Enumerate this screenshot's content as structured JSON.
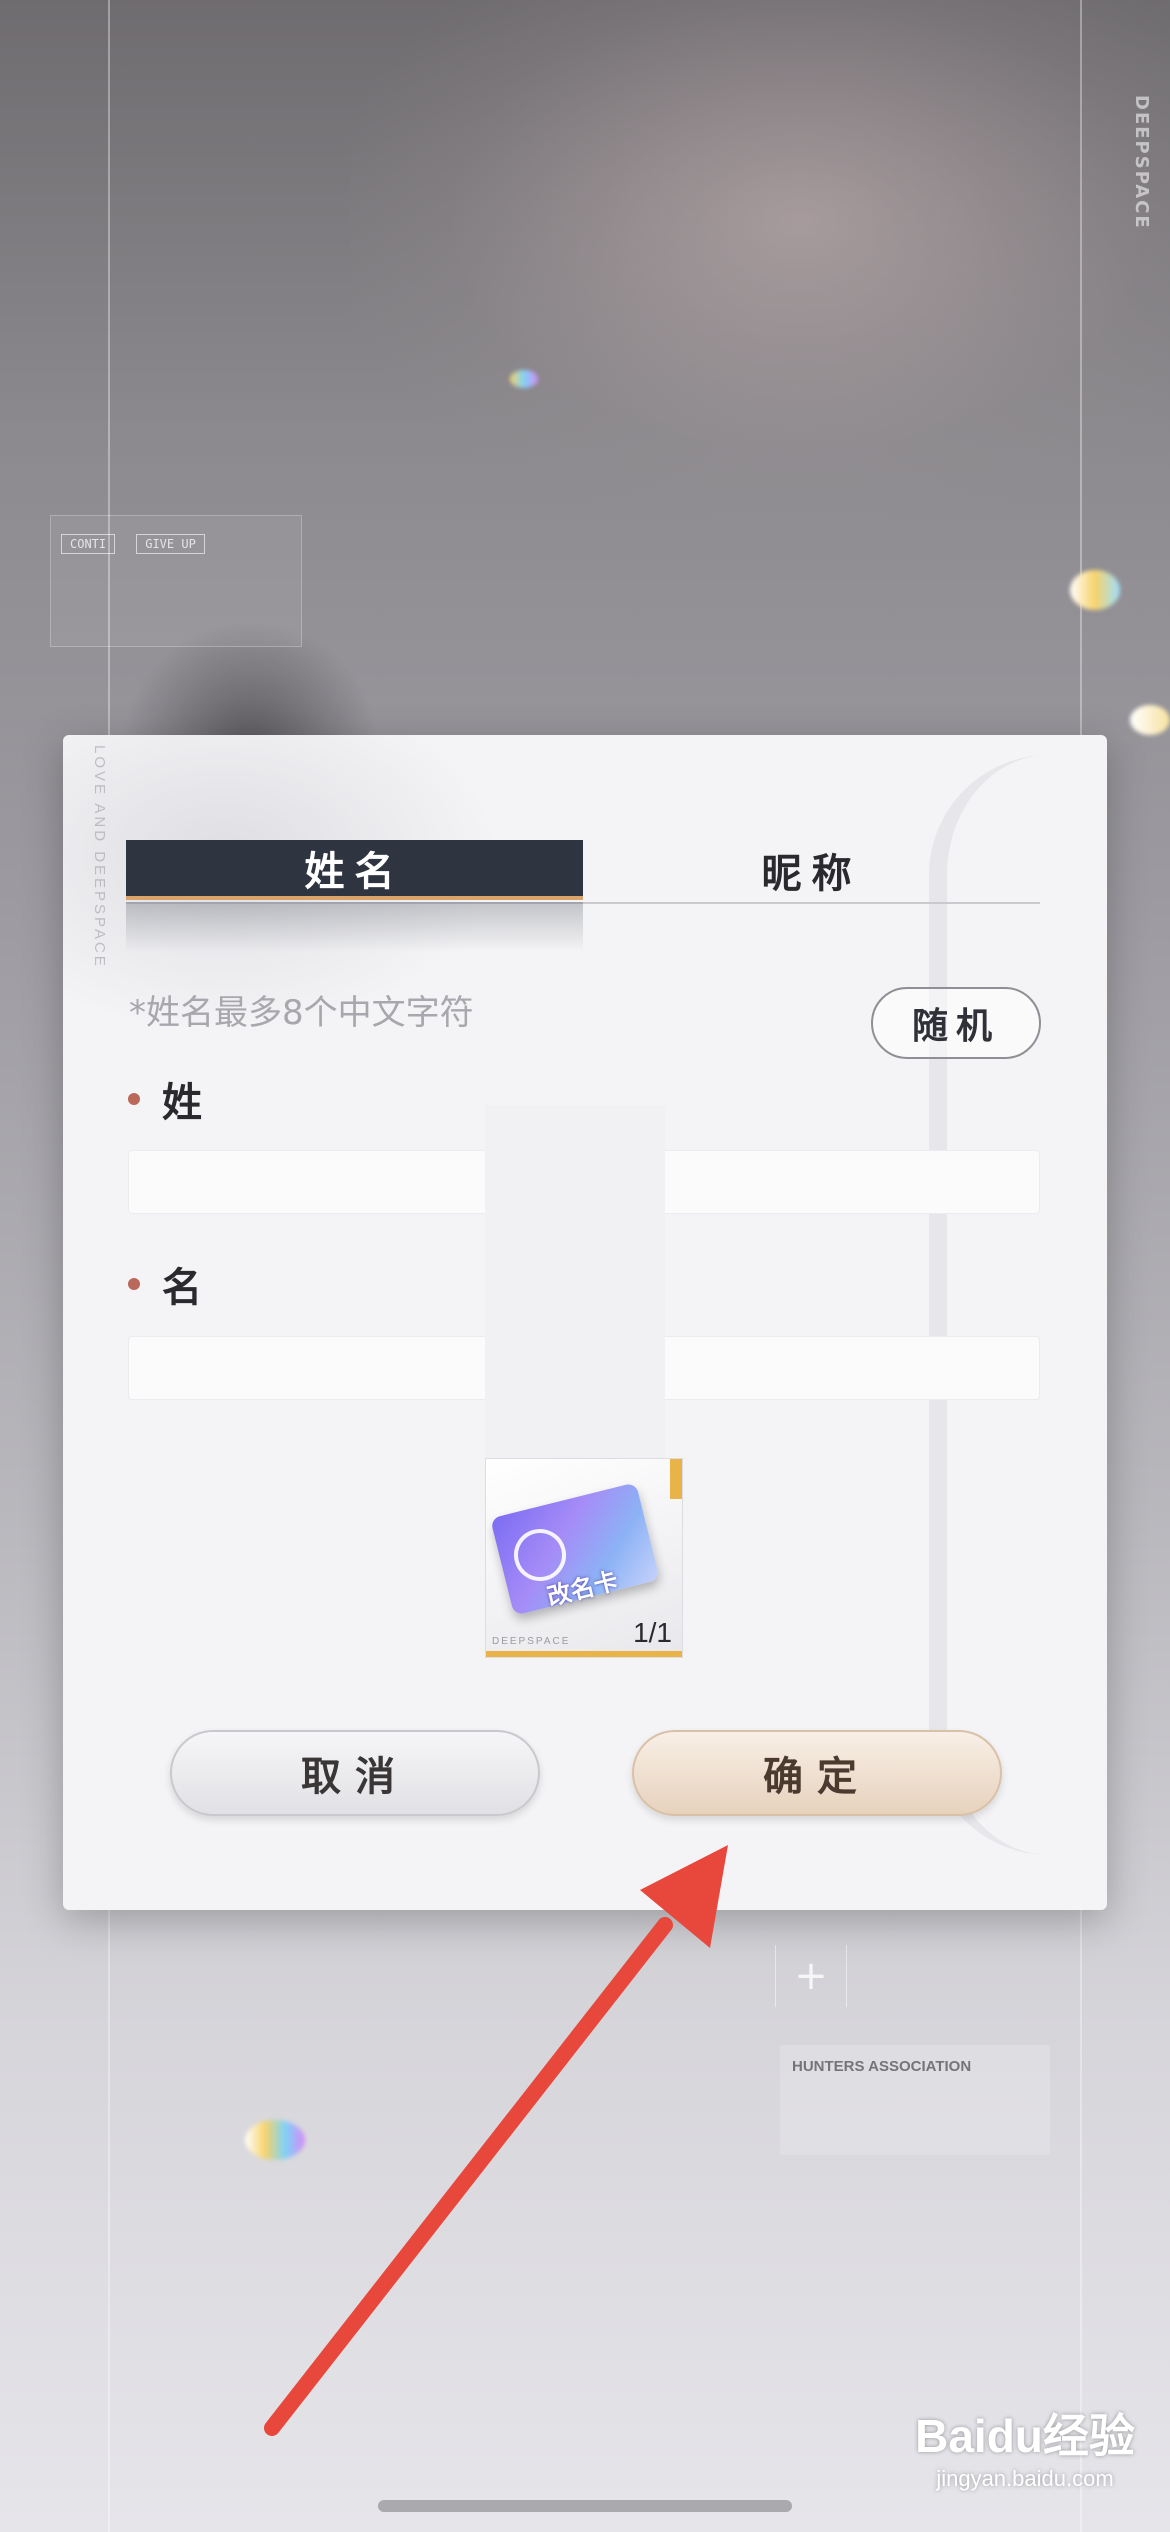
{
  "background": {
    "brand_vertical": "DEEPSPACE",
    "hud_chips": [
      "CONTI",
      "GIVE UP"
    ],
    "association_label": "HUNTERS ASSOCIATION",
    "plus_symbol": "+"
  },
  "dialog": {
    "side_text": "LOVE AND DEEPSPACE",
    "tabs": [
      {
        "label": "姓名",
        "active": true
      },
      {
        "label": "昵称",
        "active": false
      }
    ],
    "hint": "*姓名最多8个中文字符",
    "random_label": "随机",
    "surname_label": "姓",
    "given_name_label": "名",
    "surname_value": "",
    "given_name_value": "",
    "item": {
      "name": "改名卡",
      "count": "1/1",
      "brand": "DEEPSPACE"
    },
    "cancel_label": "取消",
    "confirm_label": "确定"
  },
  "watermark": {
    "main": "Baidu经验",
    "sub": "jingyan.baidu.com"
  },
  "colors": {
    "tab_active": "#2f3540",
    "tab_underline": "#d9a36a",
    "required_dot": "#b9685a",
    "confirm_button": "#e7d2bd",
    "annotation_arrow": "#e8473b"
  }
}
